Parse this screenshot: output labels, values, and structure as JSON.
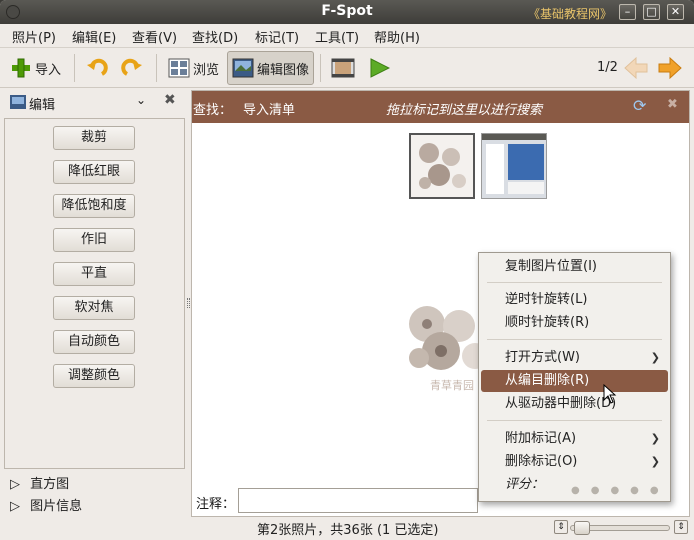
{
  "window": {
    "title": "F-Spot",
    "watermark": "《基础教程网》",
    "buttons": {
      "minimize": "–",
      "maximize": "□",
      "close": "✕"
    }
  },
  "menubar": [
    {
      "label": "照片(P)"
    },
    {
      "label": "编辑(E)"
    },
    {
      "label": "查看(V)"
    },
    {
      "label": "查找(D)"
    },
    {
      "label": "标记(T)"
    },
    {
      "label": "工具(T)"
    },
    {
      "label": "帮助(H)"
    }
  ],
  "toolbar": {
    "import_label": "导入",
    "browse_label": "浏览",
    "edit_image_label": "编辑图像",
    "pager": "1/2"
  },
  "sidebar": {
    "panel_title": "编辑",
    "buttons": [
      "裁剪",
      "降低红眼",
      "降低饱和度",
      "作旧",
      "平直",
      "软对焦",
      "自动颜色",
      "调整颜色"
    ],
    "expanders": [
      "直方图",
      "图片信息"
    ]
  },
  "findbar": {
    "find_label": "查找：",
    "import_list": "导入清单",
    "hint": "拖拉标记到这里以进行搜索"
  },
  "main": {
    "preview_caption": "青草青园",
    "comment_label": "注释："
  },
  "context_menu": {
    "items": [
      {
        "label": "复制图片位置(I)",
        "submenu": false
      },
      {
        "label": "逆时针旋转(L)",
        "submenu": false
      },
      {
        "label": "顺时针旋转(R)",
        "submenu": false
      },
      {
        "label": "打开方式(W)",
        "submenu": true
      },
      {
        "label": "从编目删除(R)",
        "submenu": false,
        "highlighted": true
      },
      {
        "label": "从驱动器中删除(D)",
        "submenu": false
      },
      {
        "label": "附加标记(A)",
        "submenu": true
      },
      {
        "label": "删除标记(O)",
        "submenu": true
      }
    ],
    "rating_label": "评分：",
    "rating_value": 0,
    "rating_max": 5
  },
  "statusbar": {
    "text": "第2张照片，共36张 (1 已选定)"
  },
  "colors": {
    "accent": "#8a5a44",
    "titlebar": "#3e3d39",
    "window_bg": "#efebe7"
  }
}
